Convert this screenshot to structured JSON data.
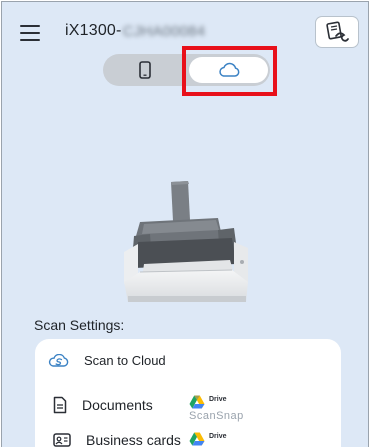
{
  "header": {
    "title_prefix": "iX1300-",
    "serial_obscured": "CJHA00084",
    "menu_icon": "hamburger-menu-icon",
    "profile_icon": "scan-profile-icon"
  },
  "segment": {
    "options": [
      {
        "name": "device",
        "icon": "smartphone-icon",
        "selected": false
      },
      {
        "name": "cloud",
        "icon": "cloud-icon",
        "selected": true
      }
    ],
    "accent_color": "#3b82c4"
  },
  "highlight_color": "#e8101a",
  "settings": {
    "label": "Scan Settings:",
    "mode": {
      "label": "Scan to Cloud",
      "icon": "scansnap-cloud-icon"
    },
    "items": [
      {
        "label": "Documents",
        "icon": "document-icon",
        "service": "Drive",
        "service_icon": "google-drive-icon",
        "sub": "ScanSnap"
      },
      {
        "label": "Business cards",
        "icon": "business-card-icon",
        "service": "Drive",
        "service_icon": "google-drive-icon",
        "sub": ""
      }
    ]
  }
}
